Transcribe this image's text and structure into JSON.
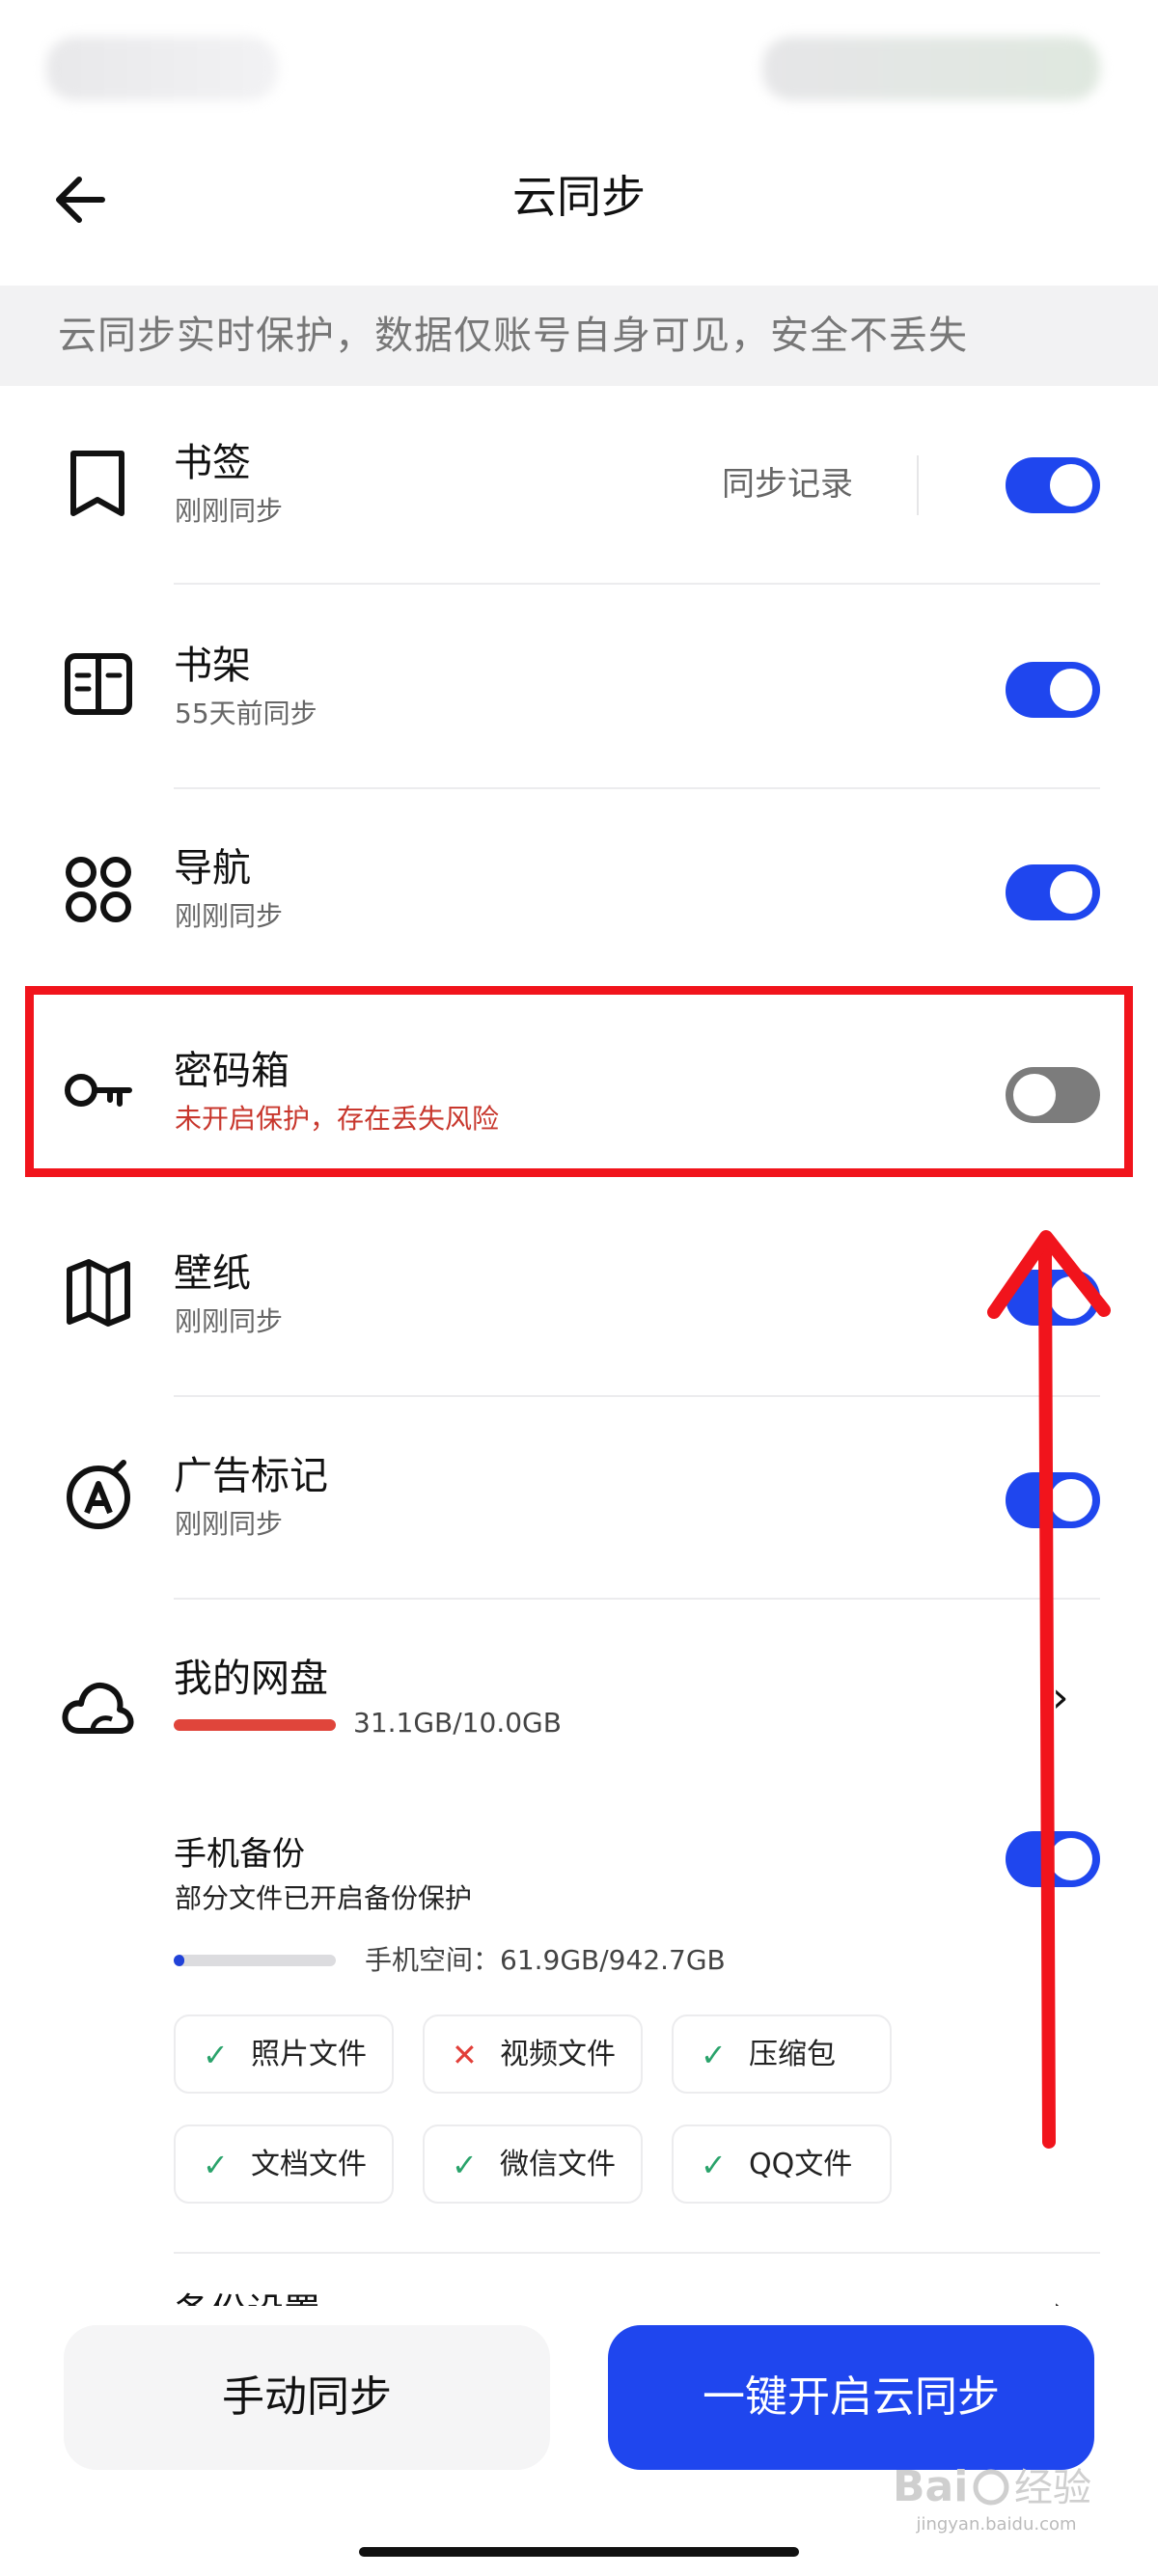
{
  "header": {
    "title": "云同步",
    "banner": "云同步实时保护，数据仅账号自身可见，安全不丢失"
  },
  "items": [
    {
      "title": "书签",
      "subtitle": "刚刚同步",
      "icon": "bookmark-icon",
      "toggle": true,
      "action": "同步记录"
    },
    {
      "title": "书架",
      "subtitle": "55天前同步",
      "icon": "book-icon",
      "toggle": true
    },
    {
      "title": "导航",
      "subtitle": "刚刚同步",
      "icon": "grid-circles-icon",
      "toggle": true
    },
    {
      "title": "密码箱",
      "subtitle": "未开启保护，存在丢失风险",
      "icon": "key-icon",
      "toggle": false
    },
    {
      "title": "壁纸",
      "subtitle": "刚刚同步",
      "icon": "map-icon",
      "toggle": true
    },
    {
      "title": "广告标记",
      "subtitle": "刚刚同步",
      "icon": "ad-mark-icon",
      "toggle": true
    }
  ],
  "cloud_disk": {
    "title": "我的网盘",
    "usage": "31.1GB/10.0GB",
    "icon": "cloud-icon"
  },
  "phone_backup": {
    "title": "手机备份",
    "subtitle": "部分文件已开启备份保护",
    "toggle": true,
    "space_label": "手机空间：61.9GB/942.7GB",
    "space_fraction": 0.066,
    "categories": [
      {
        "label": "照片文件",
        "status": "ok"
      },
      {
        "label": "视频文件",
        "status": "off"
      },
      {
        "label": "压缩包",
        "status": "ok"
      },
      {
        "label": "文档文件",
        "status": "ok"
      },
      {
        "label": "微信文件",
        "status": "ok"
      },
      {
        "label": "QQ文件",
        "status": "ok"
      }
    ]
  },
  "backup_settings": {
    "label": "备份设置"
  },
  "footer": {
    "manual_sync": "手动同步",
    "one_click_sync": "一键开启云同步"
  },
  "watermark": {
    "text": "jingyan.baidu.com"
  },
  "colors": {
    "accent": "#1f46ee",
    "warning": "#c8372d",
    "highlight": "#f1141c",
    "success": "#2aa36b"
  }
}
